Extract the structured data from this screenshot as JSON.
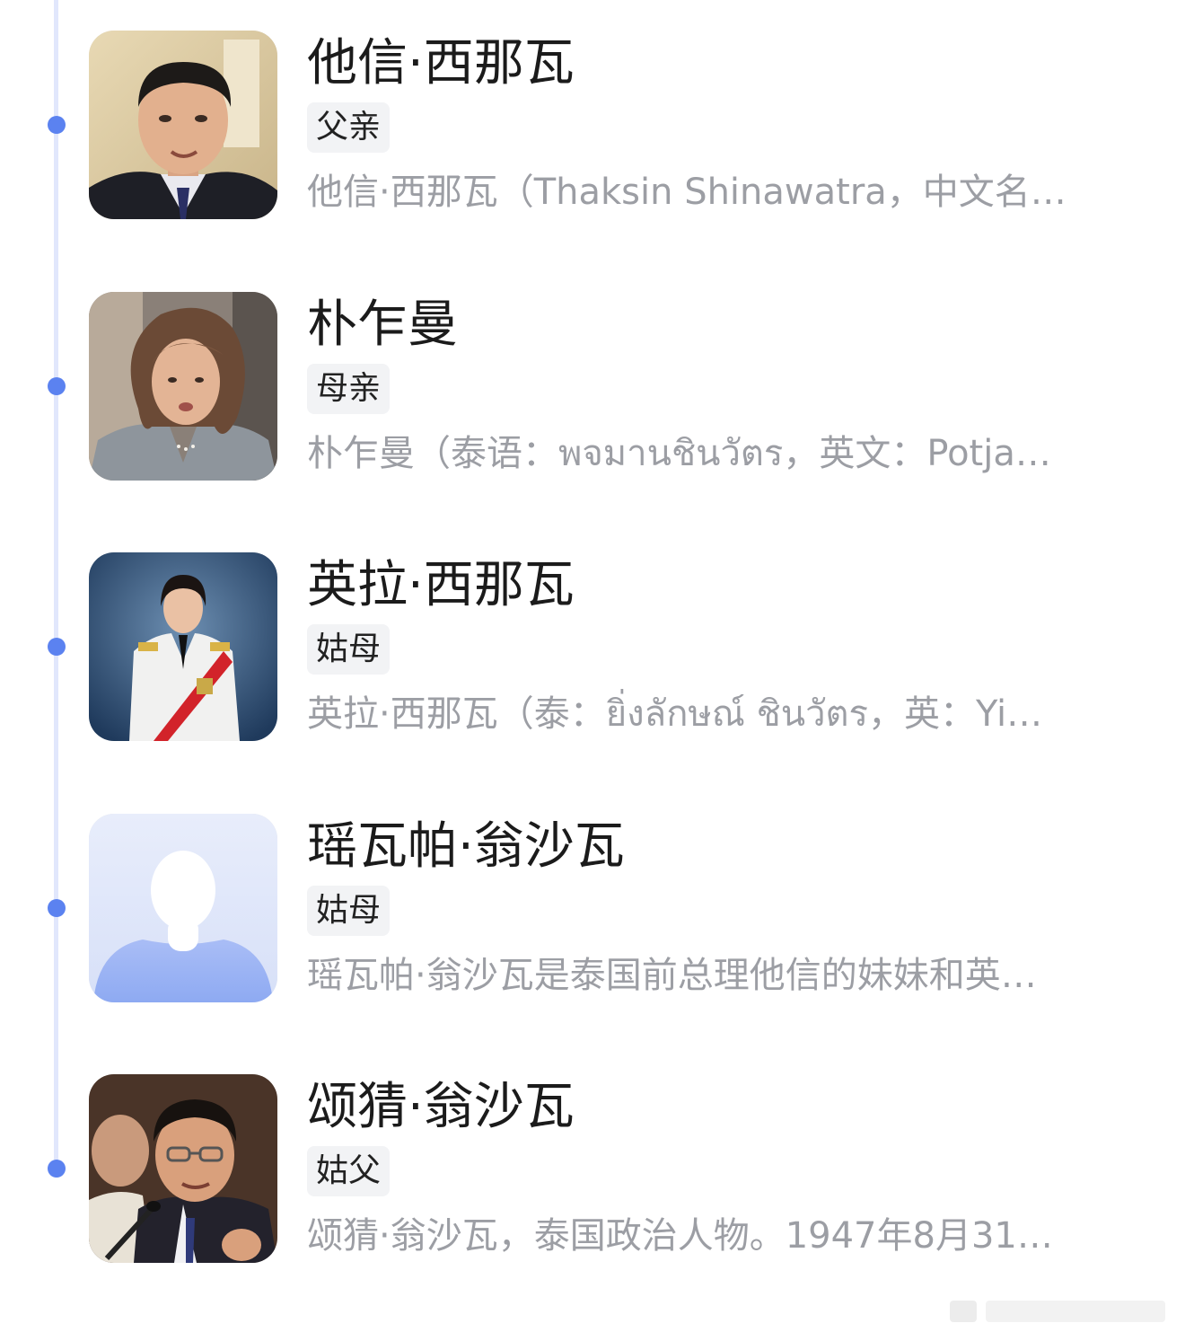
{
  "people": [
    {
      "name": "他信·西那瓦",
      "relation": "父亲",
      "summary": "他信·西那瓦（Thaksin Shinawatra，中文名…",
      "photo": "portrait-man-suit"
    },
    {
      "name": "朴乍曼",
      "relation": "母亲",
      "summary": "朴乍曼（泰语：พจมานชินวัตร，英文：Potja…",
      "photo": "portrait-woman-gray-suit"
    },
    {
      "name": "英拉·西那瓦",
      "relation": "姑母",
      "summary": "英拉·西那瓦（泰：ยิ่งลักษณ์ ชินวัตร，英：Yi…",
      "photo": "portrait-woman-white-uniform"
    },
    {
      "name": "瑶瓦帕·翁沙瓦",
      "relation": "姑母",
      "summary": "瑶瓦帕·翁沙瓦是泰国前总理他信的妹妹和英…",
      "photo": "default-avatar-placeholder"
    },
    {
      "name": "颂猜·翁沙瓦",
      "relation": "姑父",
      "summary": "颂猜·翁沙瓦，泰国政治人物。1947年8月31…",
      "photo": "portrait-man-glasses-microphone"
    }
  ],
  "colors": {
    "timeline_line": "#e1e7fc",
    "timeline_dot": "#5b82f0",
    "name_text": "#1b1b1b",
    "summary_text": "#9c9ea4",
    "tag_background": "#f2f3f5"
  }
}
